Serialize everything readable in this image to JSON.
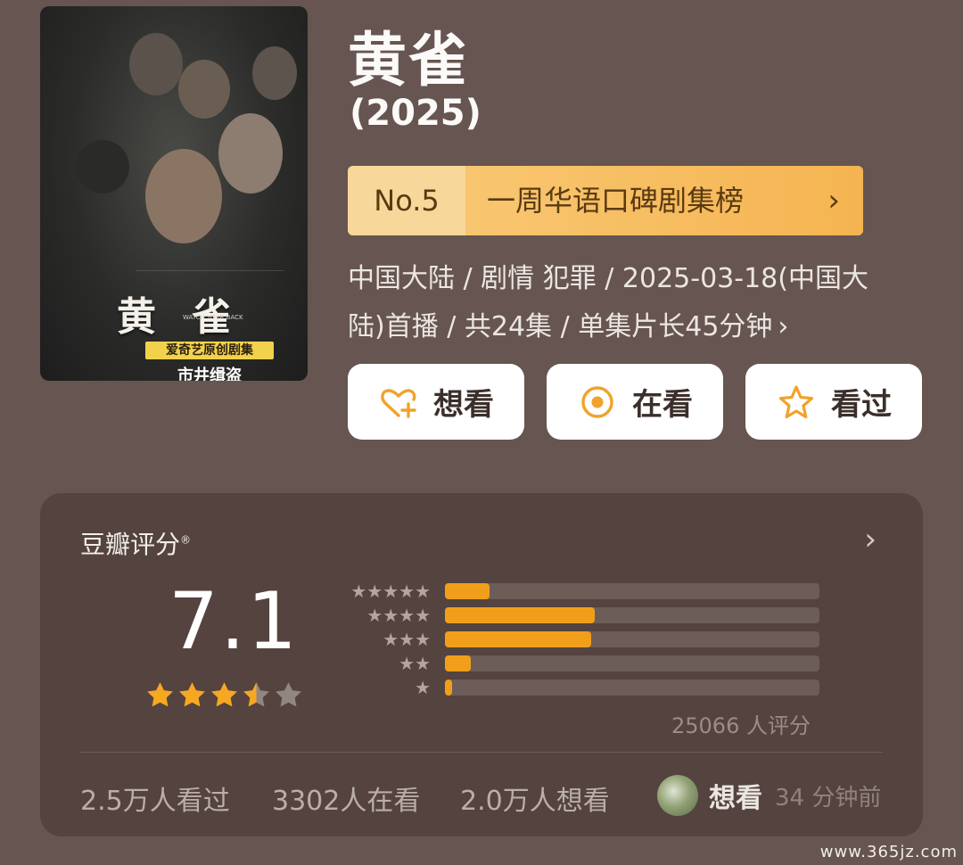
{
  "poster": {
    "title": "黄雀",
    "subtitle": "WATCH YOUR BACK",
    "badge": "爱奇艺原创剧集",
    "brand": "市井缉盗"
  },
  "title": "黄雀",
  "year": "(2025)",
  "rank": {
    "number": "No.5",
    "list_name": "一周华语口碑剧集榜",
    "arrow": "›"
  },
  "meta": {
    "line1": "中国大陆 / 剧情 犯罪 / 2025-03-18(中国大",
    "line2": "陆)首播 / 共24集 / 单集片长45分钟",
    "arrow": "›"
  },
  "actions": {
    "want": "想看",
    "watching": "在看",
    "watched": "看过"
  },
  "rating": {
    "label": "豆瓣评分",
    "trademark": "®",
    "arrow": "›",
    "score": "7.1",
    "stars_value": 3.5,
    "distribution": [
      {
        "stars": 5,
        "fraction": 0.12
      },
      {
        "stars": 4,
        "fraction": 0.4
      },
      {
        "stars": 3,
        "fraction": 0.39
      },
      {
        "stars": 2,
        "fraction": 0.07
      },
      {
        "stars": 1,
        "fraction": 0.02
      }
    ],
    "count_text": "25066 人评分"
  },
  "stats": {
    "watched": "2.5万人看过",
    "watching": "3302人在看",
    "want": "2.0万人想看"
  },
  "recent": {
    "action": "想看",
    "time": "34 分钟前"
  },
  "watermark": "www.365jz.com",
  "colors": {
    "background": "#665550",
    "card": "#54433f",
    "accent": "#f19f1b",
    "rank_bg": "#f7ba58"
  }
}
